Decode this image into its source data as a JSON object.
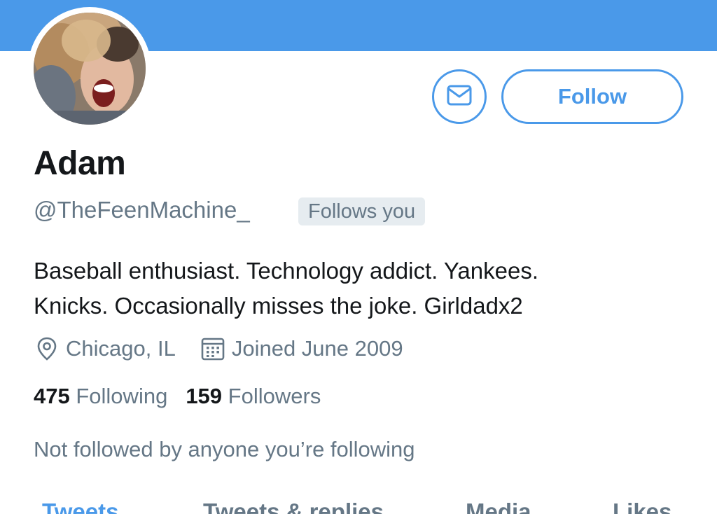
{
  "profile": {
    "name": "Adam",
    "handle": "@TheFeenMachine_",
    "follows_you_badge": "Follows you",
    "bio_line1": "Baseball enthusiast. Technology addict. Yankees.",
    "bio_line2": "Knicks. Occasionally misses the joke. Girldadx2",
    "location": "Chicago, IL",
    "joined": "Joined June 2009",
    "following_count": "475",
    "following_label": "Following",
    "followers_count": "159",
    "followers_label": "Followers",
    "not_followed_text": "Not followed by anyone you’re following"
  },
  "actions": {
    "message_icon": "envelope-icon",
    "follow_label": "Follow"
  },
  "tabs": [
    {
      "label": "Tweets",
      "active": true
    },
    {
      "label": "Tweets & replies",
      "active": false
    },
    {
      "label": "Media",
      "active": false
    },
    {
      "label": "Likes",
      "active": false
    }
  ],
  "icons": {
    "location": "location-pin-icon",
    "joined": "calendar-icon"
  },
  "colors": {
    "accent": "#4a99e9",
    "banner": "#4a99e9",
    "secondary_text": "#657786",
    "primary_text": "#14171a",
    "badge_bg": "#e6ecf0"
  }
}
